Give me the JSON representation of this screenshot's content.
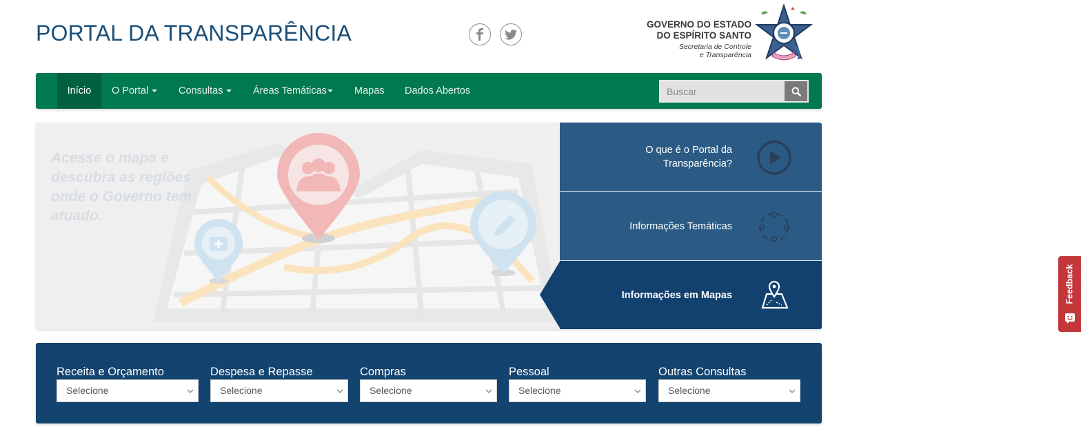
{
  "header": {
    "title": "PORTAL DA TRANSPARÊNCIA",
    "gov_line1": "GOVERNO DO ESTADO",
    "gov_line2": "DO ESPÍRITO SANTO",
    "gov_sub1": "Secretaria de Controle",
    "gov_sub2": "e Transparência",
    "social_icons": [
      "facebook-icon",
      "twitter-icon"
    ]
  },
  "nav": {
    "items": [
      {
        "label": "Início",
        "active": true
      },
      {
        "label": "O Portal",
        "dropdown": true
      },
      {
        "label": "Consultas",
        "dropdown": true
      },
      {
        "label": "Áreas Temáticas",
        "dropdown": true
      },
      {
        "label": "Mapas"
      },
      {
        "label": "Dados Abertos"
      }
    ],
    "search_placeholder": "Buscar",
    "search_icon": "search-icon"
  },
  "hero": {
    "text": "Acesse o mapa e descubra as regiões onde o Governo tem atuado.",
    "panel": [
      {
        "label": "O que é o Portal da Transparência?",
        "icon": "play-icon"
      },
      {
        "label": "Informações Temáticas",
        "icon": "people-cycle-icon"
      },
      {
        "label": "Informações em Mapas",
        "icon": "map-pin-icon"
      }
    ]
  },
  "consultas": [
    {
      "label": "Receita e Orçamento",
      "select": "Selecione"
    },
    {
      "label": "Despesa e Repasse",
      "select": "Selecione"
    },
    {
      "label": "Compras",
      "select": "Selecione"
    },
    {
      "label": "Pessoal",
      "select": "Selecione"
    },
    {
      "label": "Outras Consultas",
      "select": "Selecione"
    }
  ],
  "feedback": {
    "label": "Feedback"
  },
  "colors": {
    "title_blue": "#1b4f78",
    "nav_green": "#00794f",
    "nav_active": "#006140",
    "panel_blue": "#2b5b84",
    "panel_dark": "#12406f",
    "consult_blue": "#13436f",
    "feedback_red": "#c3373a"
  }
}
